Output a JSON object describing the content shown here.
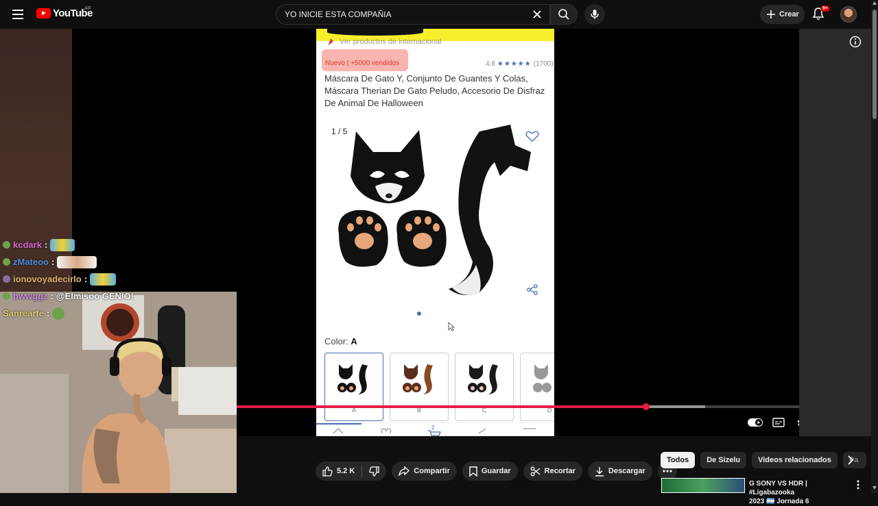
{
  "topbar": {
    "logo_text": "YouTube",
    "region": "AR",
    "search_value": "YO INICIE ESTA COMPAÑIA",
    "create_label": "Crear",
    "notifications": "9+"
  },
  "product": {
    "international": "Ver productos de internacional",
    "badge": "Nuevo  |  +5000 vendidos",
    "rating": "4.8",
    "stars": "★★★★★",
    "reviews": "(1700)",
    "title": "Máscara De Gato Y, Conjunto De Guantes Y Colas, Máscara Therian De Gato Peludo, Accesorio De Disfraz De Animal De Halloween",
    "counter": "1 / 5",
    "color_label": "Color:",
    "color_value": "A",
    "swatches": [
      "A",
      "B",
      "C",
      "D"
    ],
    "cart_count": "2"
  },
  "player": {
    "progress_played": 0.728,
    "progress_buffered": 0.833
  },
  "chat": [
    {
      "user": "kcdark",
      "sep": ":",
      "text": "",
      "color": "#d96bd0"
    },
    {
      "user": "zMateoo",
      "sep": ":",
      "text": "",
      "color": "#4e8fd9"
    },
    {
      "user": "ionovoyadecirlo",
      "sep": ":",
      "text": "",
      "color": "#e0b86a"
    },
    {
      "user": "bwwggz",
      "sep": ":",
      "text": "@Elmisoo GENIO!",
      "color": "#c98ce0"
    },
    {
      "user": "Sanrearte",
      "sep": ":",
      "text": "",
      "color": "#e6d27a"
    }
  ],
  "actions": {
    "likes": "5.2 K",
    "share": "Compartir",
    "save": "Guardar",
    "clip": "Recortar",
    "download": "Descargar"
  },
  "chips": [
    "Todos",
    "De Sizelu",
    "Videos relacionados",
    "Pa"
  ],
  "related": {
    "title_line1": "G SONY VS HDR | #Ligabazooka",
    "title_line2": "2023 🇦🇷 Jornada 6"
  }
}
